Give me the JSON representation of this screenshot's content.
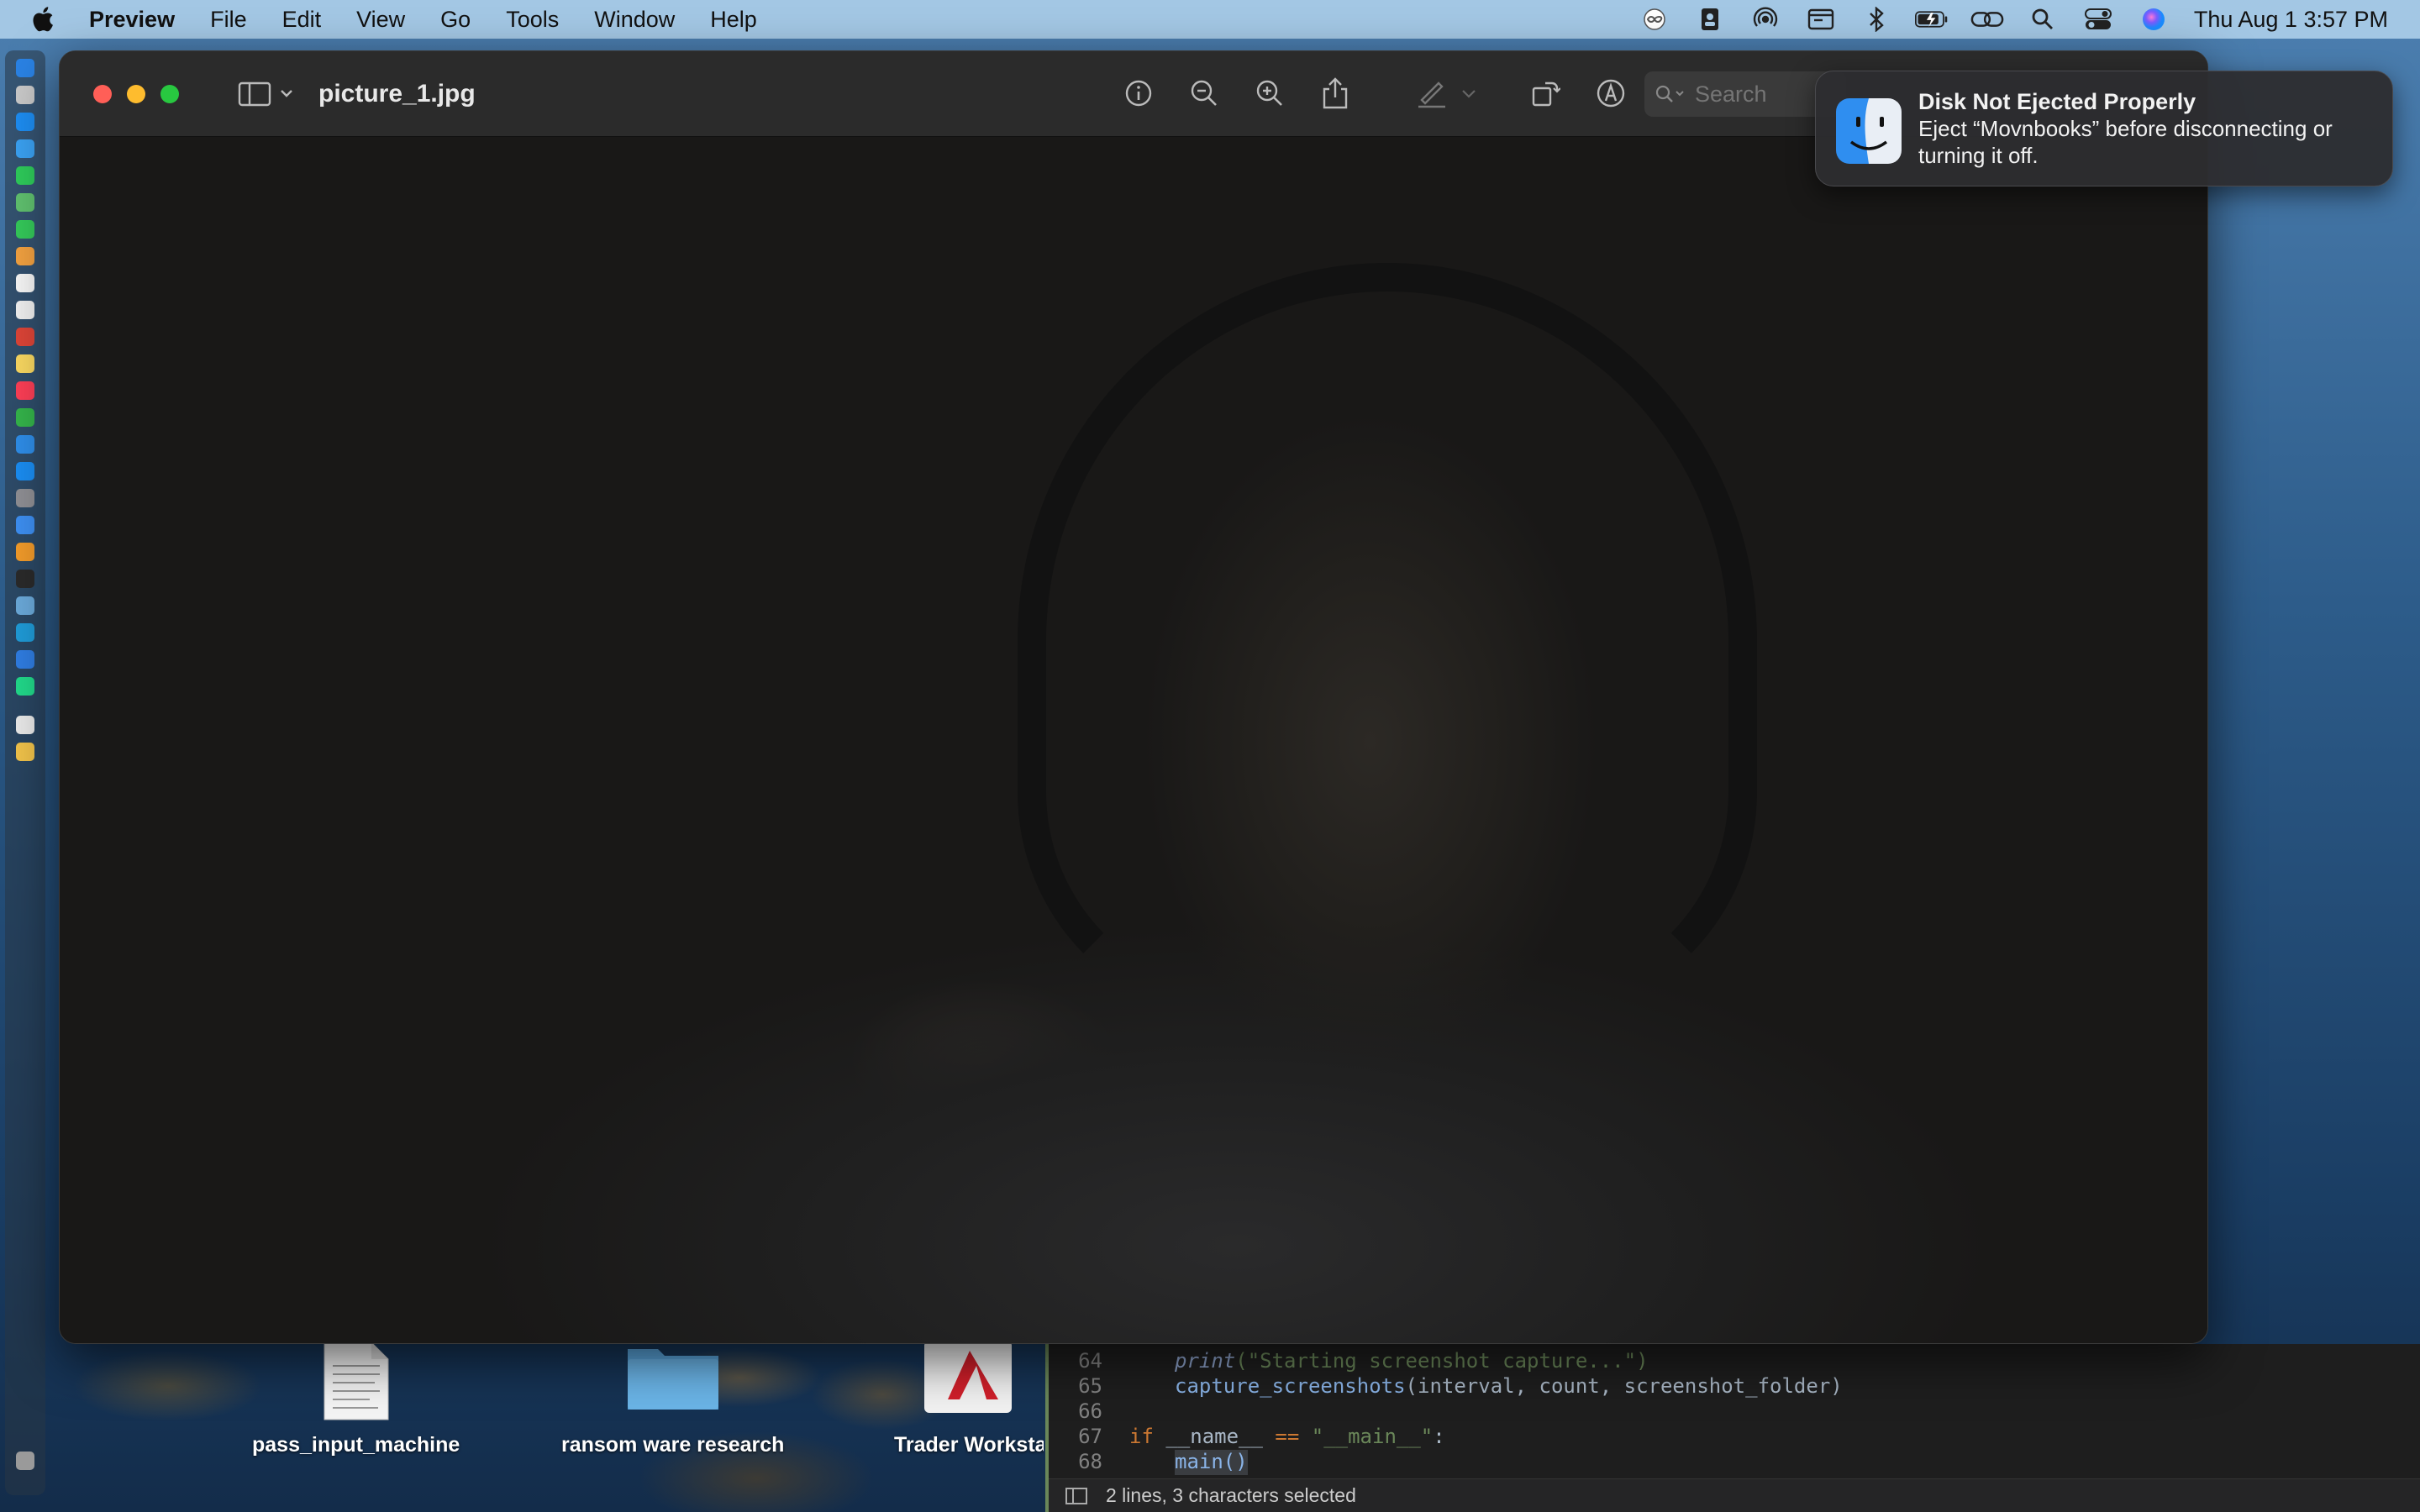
{
  "menubar": {
    "app_name": "Preview",
    "items": [
      "File",
      "Edit",
      "View",
      "Go",
      "Tools",
      "Window",
      "Help"
    ],
    "clock": "Thu Aug 1  3:57 PM",
    "status_icons": [
      "infinity-icon",
      "contacts-icon",
      "airdrop-icon",
      "display-icon",
      "bluetooth-icon",
      "battery-icon",
      "link-icon",
      "spotlight-icon",
      "control-center-icon",
      "siri-icon"
    ]
  },
  "window": {
    "title": "picture_1.jpg",
    "search_placeholder": "Search"
  },
  "notification": {
    "title": "Disk Not Ejected Properly",
    "body": "Eject “Movnbooks” before disconnecting or turning it off."
  },
  "desktop_icons": [
    {
      "label": "pass_input_machine"
    },
    {
      "label": "ransom ware research"
    },
    {
      "label": "Trader Worksta"
    }
  ],
  "editor": {
    "lines": [
      {
        "no": "64"
      },
      {
        "no": "65"
      },
      {
        "no": "66"
      },
      {
        "no": "67"
      },
      {
        "no": "68"
      }
    ],
    "code": {
      "l64_fn": "print",
      "l64_rest": "(\"Starting screenshot capture...\")",
      "l65_fn": "capture_screenshots",
      "l65_rest": "(interval, count, screenshot_folder)",
      "l67_kw": "if",
      "l67_name": " __name__ ",
      "l67_eq": "==",
      "l67_str": " \"__main__\"",
      "l67_colon": ":",
      "l68": "main()"
    },
    "status": "2 lines, 3 characters selected"
  }
}
